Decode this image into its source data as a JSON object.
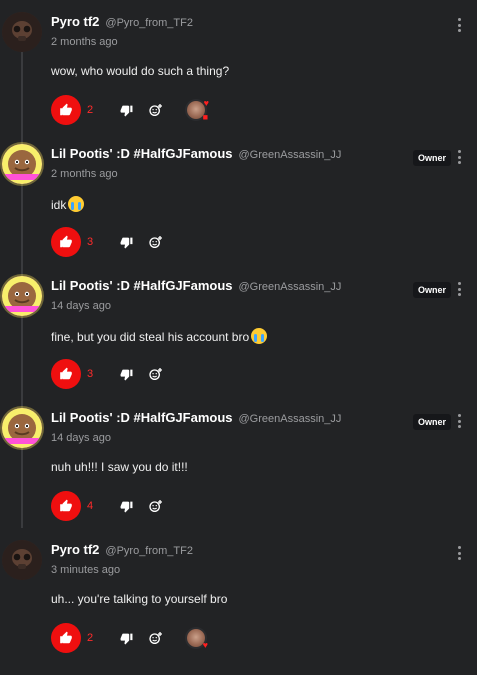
{
  "comments": [
    {
      "username": "Pyro tf2",
      "handle": "@Pyro_from_TF2",
      "time": "2 months ago",
      "text": "wow, who would do such a thing?",
      "likes": "2",
      "owner_badge": "",
      "reaction": {
        "avatar_icon": "creator-avatar-icon",
        "heart_icon": "heart-icon"
      },
      "has_cry_emoji": false
    },
    {
      "username": "Lil Pootis' :D #HalfGJFamous",
      "handle": "@GreenAssassin_JJ",
      "time": "2 months ago",
      "text": "idk",
      "likes": "3",
      "owner_badge": "Owner",
      "has_cry_emoji": true
    },
    {
      "username": "Lil Pootis' :D #HalfGJFamous",
      "handle": "@GreenAssassin_JJ",
      "time": "14 days ago",
      "text": "fine, but you did steal his account bro",
      "likes": "3",
      "owner_badge": "Owner",
      "has_cry_emoji": true
    },
    {
      "username": "Lil Pootis' :D #HalfGJFamous",
      "handle": "@GreenAssassin_JJ",
      "time": "14 days ago",
      "text": "nuh uh!!! I saw you do it!!!",
      "likes": "4",
      "owner_badge": "Owner",
      "has_cry_emoji": false
    },
    {
      "username": "Pyro tf2",
      "handle": "@Pyro_from_TF2",
      "time": "3 minutes ago",
      "text": "uh... you're talking to yourself bro",
      "likes": "2",
      "owner_badge": "",
      "reaction": {
        "avatar_icon": "creator-avatar-icon",
        "heart_icon": "heart-icon"
      },
      "has_cry_emoji": false
    }
  ],
  "icons": {
    "like": "thumbs-up-icon",
    "dislike": "thumbs-down-icon",
    "react": "add-reaction-icon",
    "menu": "more-vert-icon",
    "cry": "loudly-crying-face-icon"
  },
  "colors": {
    "background": "#222325",
    "like_active": "#ef0f0f",
    "like_count": "#ff2b2b",
    "username": "#ffffff",
    "muted": "#9b9c9f",
    "owner_badge_bg": "#16171a"
  }
}
